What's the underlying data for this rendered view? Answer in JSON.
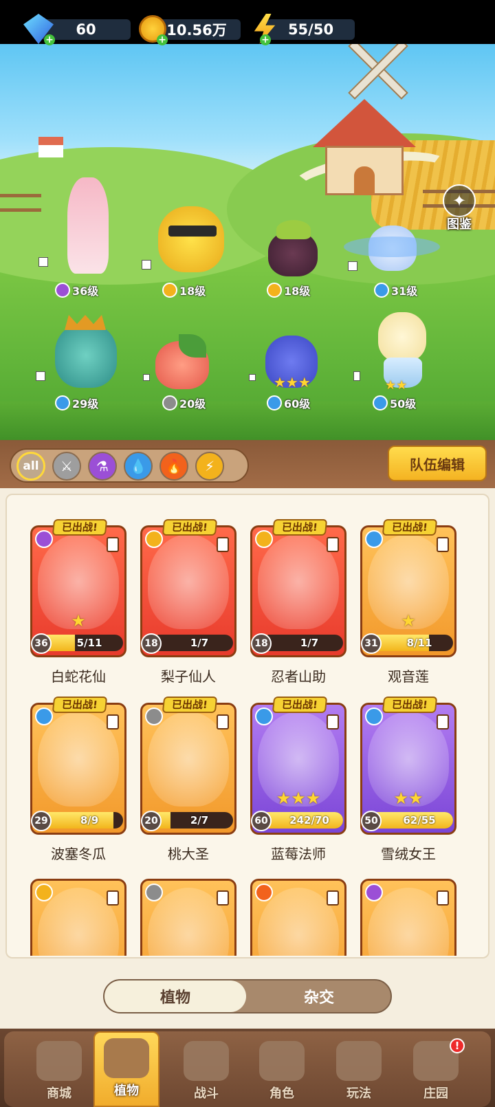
{
  "currencies": [
    {
      "name": "gem",
      "value": "60"
    },
    {
      "name": "coin",
      "value": "10.56万"
    },
    {
      "name": "energy",
      "value": "55/50"
    }
  ],
  "atlas_label": "图鉴",
  "scene_team": [
    {
      "level": "36级",
      "element": "potion",
      "element_color": "#9b4fd6"
    },
    {
      "level": "18级",
      "element": "lightning",
      "element_color": "#f3b21c"
    },
    {
      "level": "18级",
      "element": "lightning",
      "element_color": "#f3b21c"
    },
    {
      "level": "31级",
      "element": "water",
      "element_color": "#3a9ae8"
    },
    {
      "level": "29级",
      "element": "water",
      "element_color": "#3a9ae8"
    },
    {
      "level": "20级",
      "element": "blade",
      "element_color": "#8c8c8c"
    },
    {
      "level": "60级",
      "element": "water",
      "element_color": "#3a9ae8"
    },
    {
      "level": "50级",
      "element": "water",
      "element_color": "#3a9ae8"
    }
  ],
  "filters": {
    "all_label": "all",
    "elements": [
      "blade",
      "potion",
      "water",
      "fire",
      "lightning"
    ]
  },
  "team_edit_label": "队伍编辑",
  "deployed_label": "已出战!",
  "cards": [
    {
      "name": "白蛇花仙",
      "level": "36",
      "progress": "5/11",
      "fill": 0.45,
      "rarity": "red",
      "element_color": "#9b4fd6",
      "stars": "★"
    },
    {
      "name": "梨子仙人",
      "level": "18",
      "progress": "1/7",
      "fill": 0.14,
      "rarity": "red",
      "element_color": "#f3b21c",
      "stars": ""
    },
    {
      "name": "忍者山助",
      "level": "18",
      "progress": "1/7",
      "fill": 0.14,
      "rarity": "red",
      "element_color": "#f3b21c",
      "stars": ""
    },
    {
      "name": "观音莲",
      "level": "31",
      "progress": "8/11",
      "fill": 0.73,
      "rarity": "gold",
      "element_color": "#3a9ae8",
      "stars": "★"
    },
    {
      "name": "波塞冬瓜",
      "level": "29",
      "progress": "8/9",
      "fill": 0.89,
      "rarity": "gold",
      "element_color": "#3a9ae8",
      "stars": ""
    },
    {
      "name": "桃大圣",
      "level": "20",
      "progress": "2/7",
      "fill": 0.29,
      "rarity": "gold",
      "element_color": "#8c8c8c",
      "stars": ""
    },
    {
      "name": "蓝莓法师",
      "level": "60",
      "progress": "242/70",
      "fill": 1,
      "rarity": "purple",
      "element_color": "#3a9ae8",
      "stars": "★★★"
    },
    {
      "name": "雪绒女王",
      "level": "50",
      "progress": "62/55",
      "fill": 1,
      "rarity": "purple",
      "element_color": "#3a9ae8",
      "stars": "★★"
    }
  ],
  "partial_cards": [
    {
      "rarity": "gold",
      "element_color": "#f3b21c"
    },
    {
      "rarity": "gold",
      "element_color": "#8c8c8c"
    },
    {
      "rarity": "gold",
      "element_color": "#f2621c"
    },
    {
      "rarity": "gold",
      "element_color": "#9b4fd6"
    }
  ],
  "toggle": {
    "active": "植物",
    "inactive": "杂交"
  },
  "nav": [
    {
      "label": "商城",
      "active": false
    },
    {
      "label": "植物",
      "active": true
    },
    {
      "label": "战斗",
      "active": false
    },
    {
      "label": "角色",
      "active": false
    },
    {
      "label": "玩法",
      "active": false
    },
    {
      "label": "庄园",
      "active": false,
      "badge": "!"
    }
  ],
  "colors": {
    "accent": "#f4b322",
    "panel": "#f5eedf",
    "nav": "#6d4731"
  }
}
